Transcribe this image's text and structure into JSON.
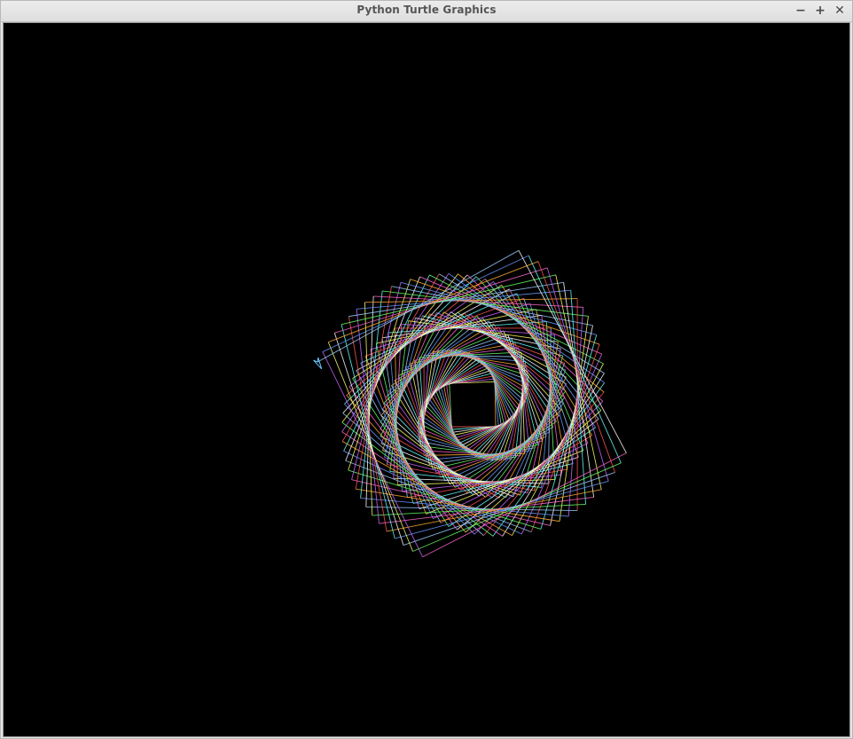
{
  "window": {
    "title": "Python Turtle Graphics",
    "controls": {
      "minimize": "−",
      "maximize": "+",
      "close": "✕"
    }
  },
  "canvas": {
    "background": "#000000",
    "pattern": "rotating-squares-spiral",
    "palette": [
      "#ff5555",
      "#ffaa33",
      "#ffff66",
      "#66ff66",
      "#66ffff",
      "#6699ff",
      "#cc66ff",
      "#ff66cc",
      "#ffffff",
      "#99ccff"
    ],
    "turtle_icon": "turtle-arrow-icon",
    "turtle_color": "#66ccff"
  }
}
